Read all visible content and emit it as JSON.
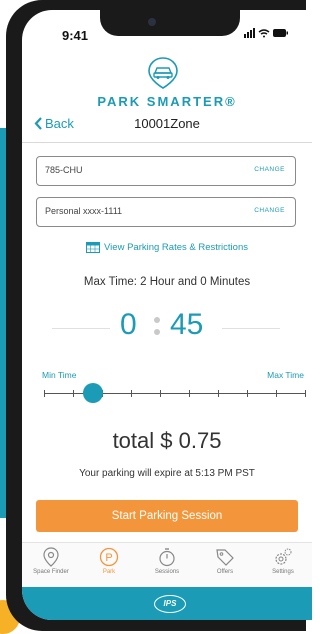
{
  "status": {
    "time": "9:41",
    "icons": "▐▐ • ▬"
  },
  "brand": {
    "name": "PARK SMARTER®"
  },
  "nav": {
    "back_label": "Back",
    "title": "10001Zone"
  },
  "vehicle": {
    "value": "785-CHU",
    "change_label": "CHANGE"
  },
  "payment": {
    "value": "Personal xxxx-1111",
    "change_label": "CHANGE"
  },
  "rates_link": "View Parking Rates & Restrictions",
  "max_time": "Max Time: 2 Hour and 0 Minutes",
  "timer": {
    "hours": "0",
    "minutes": "45"
  },
  "slider": {
    "min_label": "Min Time",
    "max_label": "Max Time",
    "level": 0.25
  },
  "total": "total $ 0.75",
  "expire": "Your parking will expire at 5:13 PM PST",
  "start_button": "Start Parking Session",
  "tabs": [
    {
      "label": "Space Finder",
      "icon": "map-pin-icon"
    },
    {
      "label": "Park",
      "icon": "parking-icon",
      "active": true
    },
    {
      "label": "Sessions",
      "icon": "stopwatch-icon"
    },
    {
      "label": "Offers",
      "icon": "tag-icon"
    },
    {
      "label": "Settings",
      "icon": "gear-icon"
    }
  ],
  "footer_logo": "IPS",
  "colors": {
    "accent": "#1b9bb5",
    "cta": "#f3963b"
  }
}
